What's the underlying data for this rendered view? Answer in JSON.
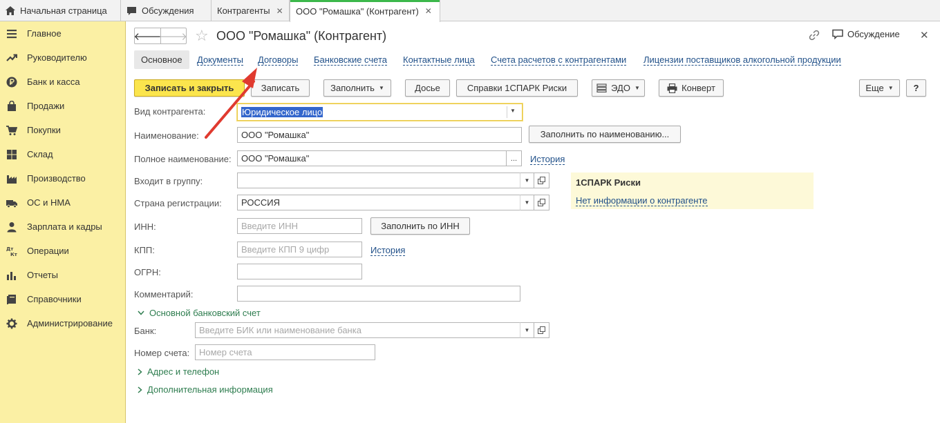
{
  "top_tabs": [
    {
      "label": "Начальная страница",
      "icon": "home-icon",
      "closable": false
    },
    {
      "label": "Обсуждения",
      "icon": "chat-icon",
      "closable": false
    },
    {
      "label": "Контрагенты",
      "closable": true
    },
    {
      "label": "ООО \"Ромашка\" (Контрагент)",
      "closable": true,
      "active": true
    }
  ],
  "sidebar": {
    "items": [
      {
        "label": "Главное",
        "icon": "menu-icon"
      },
      {
        "label": "Руководителю",
        "icon": "trend-icon"
      },
      {
        "label": "Банк и касса",
        "icon": "ruble-icon"
      },
      {
        "label": "Продажи",
        "icon": "bag-icon"
      },
      {
        "label": "Покупки",
        "icon": "cart-icon"
      },
      {
        "label": "Склад",
        "icon": "warehouse-icon"
      },
      {
        "label": "Производство",
        "icon": "factory-icon"
      },
      {
        "label": "ОС и НМА",
        "icon": "truck-icon"
      },
      {
        "label": "Зарплата и кадры",
        "icon": "person-icon"
      },
      {
        "label": "Операции",
        "icon": "dt-kt-icon",
        "icon_text": "Дт Кт"
      },
      {
        "label": "Отчеты",
        "icon": "bar-chart-icon"
      },
      {
        "label": "Справочники",
        "icon": "book-icon"
      },
      {
        "label": "Администрирование",
        "icon": "gear-icon"
      }
    ]
  },
  "header": {
    "title": "ООО \"Ромашка\" (Контрагент)",
    "discussion_label": "Обсуждение"
  },
  "section_tabs": [
    "Основное",
    "Документы",
    "Договоры",
    "Банковские счета",
    "Контактные лица",
    "Счета расчетов с контрагентами",
    "Лицензии поставщиков алкогольной продукции"
  ],
  "toolbar": {
    "save_close": "Записать и закрыть",
    "save": "Записать",
    "fill": "Заполнить",
    "dossier": "Досье",
    "spark_reports": "Справки 1СПАРК Риски",
    "edo": "ЭДО",
    "envelope": "Конверт",
    "more": "Еще",
    "help": "?"
  },
  "form": {
    "kind": {
      "label": "Вид контрагента:",
      "value": "Юридическое лицо"
    },
    "name": {
      "label": "Наименование:",
      "value": "ООО \"Ромашка\"",
      "button": "Заполнить по наименованию..."
    },
    "full_name": {
      "label": "Полное наименование:",
      "value": "ООО \"Ромашка\"",
      "button": "...",
      "history": "История"
    },
    "group": {
      "label": "Входит в группу:",
      "value": ""
    },
    "country": {
      "label": "Страна регистрации:",
      "value": "РОССИЯ"
    },
    "inn": {
      "label": "ИНН:",
      "placeholder": "Введите ИНН",
      "button": "Заполнить по ИНН"
    },
    "kpp": {
      "label": "КПП:",
      "placeholder": "Введите КПП 9 цифр",
      "history": "История"
    },
    "ogrn": {
      "label": "ОГРН:",
      "value": ""
    },
    "comment": {
      "label": "Комментарий:",
      "value": ""
    }
  },
  "spark": {
    "title": "1СПАРК Риски",
    "link": "Нет информации о контрагенте"
  },
  "bank_section": {
    "title": "Основной банковский счет",
    "expanded": true,
    "bank": {
      "label": "Банк:",
      "placeholder": "Введите БИК или наименование банка"
    },
    "account": {
      "label": "Номер счета:",
      "placeholder": "Номер счета"
    }
  },
  "collapsed_groups": [
    "Адрес и телефон",
    "Дополнительная информация"
  ],
  "colors": {
    "sidebar_bg": "#fbf0a4",
    "primary_button": "#fbe54d",
    "link": "#1f4f88",
    "group_title": "#2e7d4f",
    "active_tab_accent": "#3cb84b",
    "annotation_arrow": "#e03a2f"
  }
}
